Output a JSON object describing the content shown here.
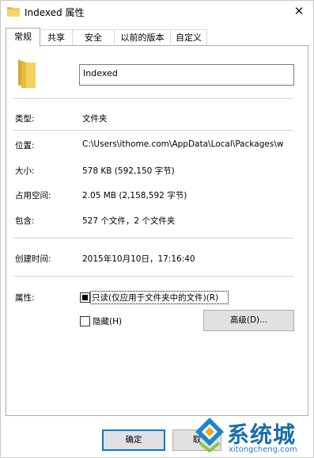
{
  "window": {
    "title": "Indexed 属性",
    "close_symbol": "✕",
    "icon": "folder-icon"
  },
  "tabs": [
    {
      "label": "常规",
      "active": true
    },
    {
      "label": "共享",
      "active": false
    },
    {
      "label": "安全",
      "active": false
    },
    {
      "label": "以前的版本",
      "active": false
    },
    {
      "label": "自定义",
      "active": false
    }
  ],
  "general": {
    "folder_name": "Indexed",
    "type_label": "类型:",
    "type_value": "文件夹",
    "location_label": "位置:",
    "location_value": "C:\\Users\\ithome.com\\AppData\\Local\\Packages\\w",
    "size_label": "大小:",
    "size_value": "578 KB (592,150 字节)",
    "disk_size_label": "占用空间:",
    "disk_size_value": "2.05 MB (2,158,592 字节)",
    "contains_label": "包含:",
    "contains_value": "527 个文件，2 个文件夹",
    "created_label": "创建时间:",
    "created_value": "2015年10月10日，17:16:40",
    "attributes_label": "属性:",
    "readonly_label": "只读(仅应用于文件夹中的文件)(R)",
    "readonly_state": "indeterminate",
    "hidden_label": "隐藏(H)",
    "hidden_checked": false,
    "advanced_button": "高级(D)..."
  },
  "footer": {
    "ok_button": "确定",
    "cancel_button": "取"
  },
  "watermark": {
    "brand": "系统城",
    "url": "xitongcheng.com"
  },
  "colors": {
    "focus_blue": "#0078d7",
    "folder_yellow": "#f2c94c",
    "watermark_blue": "#1a6fa8"
  }
}
